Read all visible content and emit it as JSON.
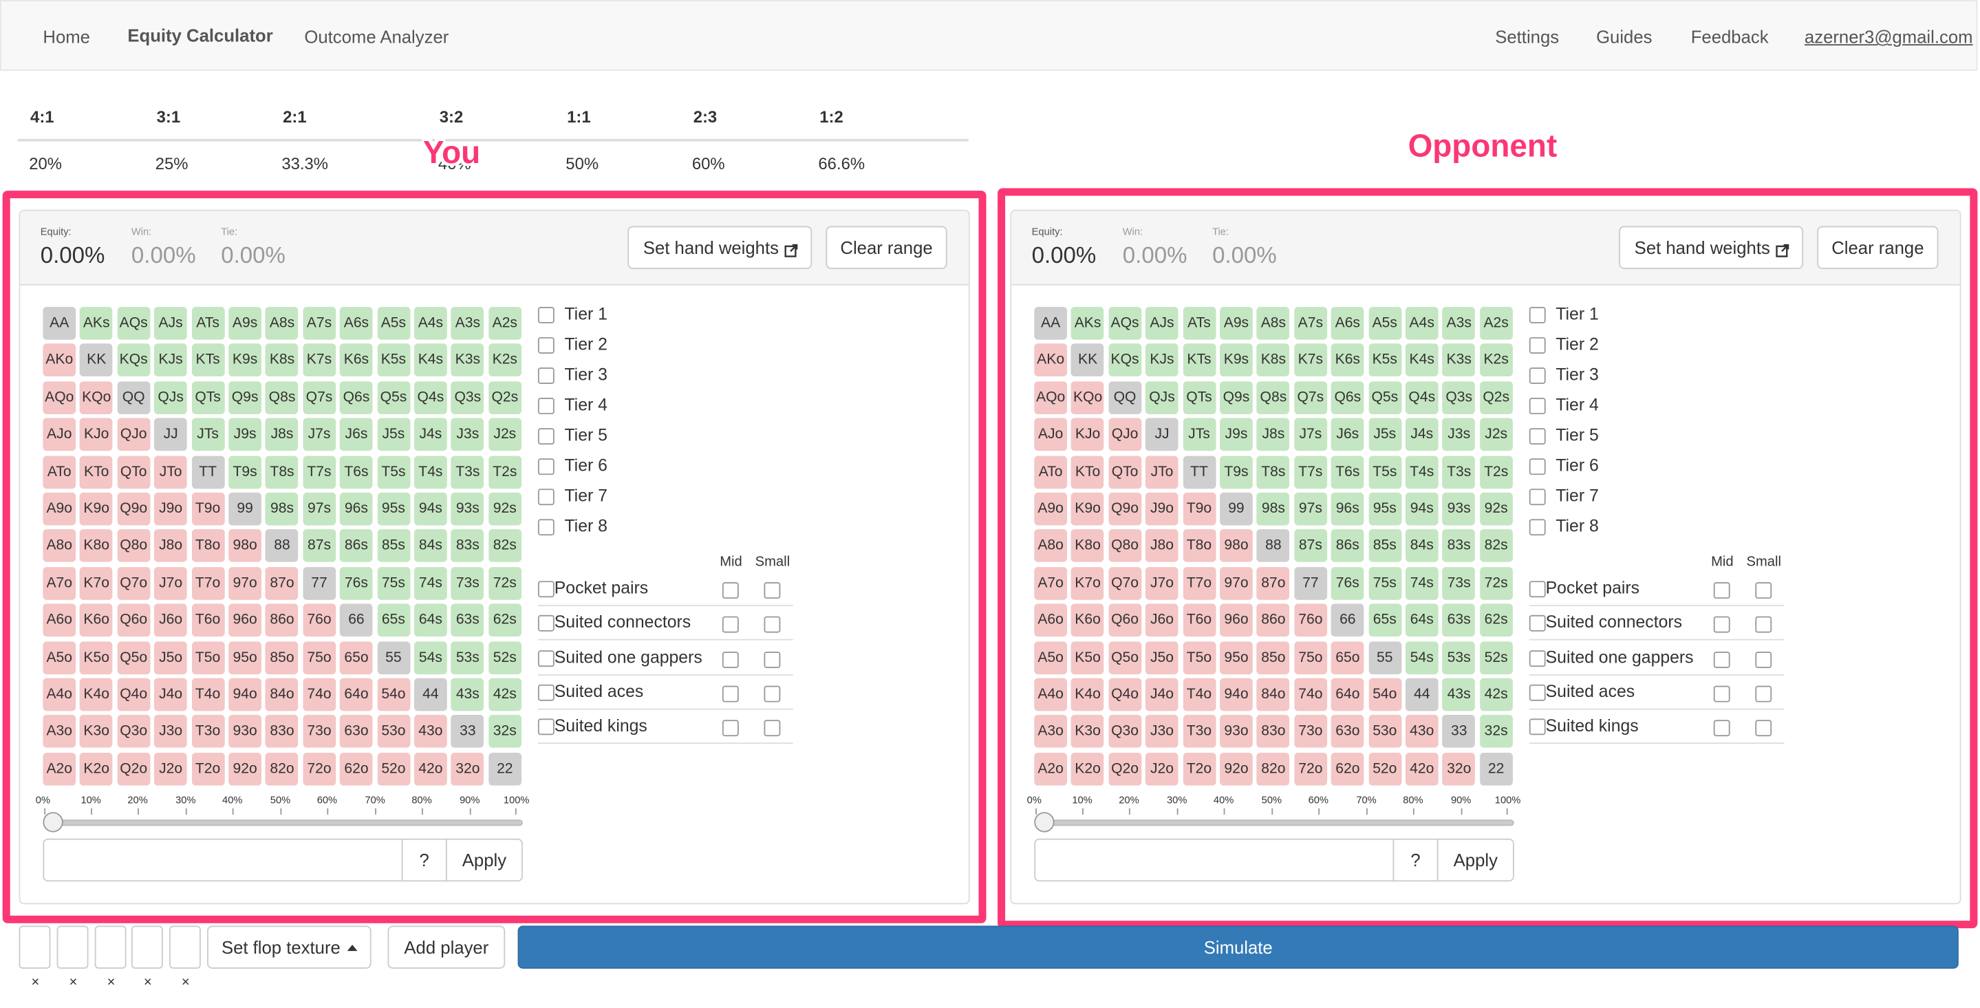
{
  "nav": {
    "home": "Home",
    "equity_calculator": "Equity Calculator",
    "outcome_analyzer": "Outcome Analyzer",
    "settings": "Settings",
    "guides": "Guides",
    "feedback": "Feedback",
    "user_email": "azerner3@gmail.com"
  },
  "odds_table": {
    "headers": [
      "4:1",
      "3:1",
      "2:1",
      "3:2",
      "1:1",
      "2:3",
      "1:2"
    ],
    "values": [
      "20%",
      "25%",
      "33.3%",
      "40%",
      "50%",
      "60%",
      "66.6%"
    ]
  },
  "annotations": {
    "you": "You",
    "opponent": "Opponent",
    "highlight_color": "#fb3774"
  },
  "panels": [
    {
      "equity_label": "Equity:",
      "equity_value": "0.00%",
      "win_label": "Win:",
      "win_value": "0.00%",
      "tie_label": "Tie:",
      "tie_value": "0.00%",
      "set_hand_weights": "Set hand weights",
      "clear_range": "Clear range",
      "range_input_value": "",
      "help_button": "?",
      "apply_button": "Apply",
      "slider_percent": 0
    },
    {
      "equity_label": "Equity:",
      "equity_value": "0.00%",
      "win_label": "Win:",
      "win_value": "0.00%",
      "tie_label": "Tie:",
      "tie_value": "0.00%",
      "set_hand_weights": "Set hand weights",
      "clear_range": "Clear range",
      "range_input_value": "",
      "help_button": "?",
      "apply_button": "Apply",
      "slider_percent": 0
    }
  ],
  "hand_grid": [
    [
      "AA",
      "AKs",
      "AQs",
      "AJs",
      "ATs",
      "A9s",
      "A8s",
      "A7s",
      "A6s",
      "A5s",
      "A4s",
      "A3s",
      "A2s"
    ],
    [
      "AKo",
      "KK",
      "KQs",
      "KJs",
      "KTs",
      "K9s",
      "K8s",
      "K7s",
      "K6s",
      "K5s",
      "K4s",
      "K3s",
      "K2s"
    ],
    [
      "AQo",
      "KQo",
      "QQ",
      "QJs",
      "QTs",
      "Q9s",
      "Q8s",
      "Q7s",
      "Q6s",
      "Q5s",
      "Q4s",
      "Q3s",
      "Q2s"
    ],
    [
      "AJo",
      "KJo",
      "QJo",
      "JJ",
      "JTs",
      "J9s",
      "J8s",
      "J7s",
      "J6s",
      "J5s",
      "J4s",
      "J3s",
      "J2s"
    ],
    [
      "ATo",
      "KTo",
      "QTo",
      "JTo",
      "TT",
      "T9s",
      "T8s",
      "T7s",
      "T6s",
      "T5s",
      "T4s",
      "T3s",
      "T2s"
    ],
    [
      "A9o",
      "K9o",
      "Q9o",
      "J9o",
      "T9o",
      "99",
      "98s",
      "97s",
      "96s",
      "95s",
      "94s",
      "93s",
      "92s"
    ],
    [
      "A8o",
      "K8o",
      "Q8o",
      "J8o",
      "T8o",
      "98o",
      "88",
      "87s",
      "86s",
      "85s",
      "84s",
      "83s",
      "82s"
    ],
    [
      "A7o",
      "K7o",
      "Q7o",
      "J7o",
      "T7o",
      "97o",
      "87o",
      "77",
      "76s",
      "75s",
      "74s",
      "73s",
      "72s"
    ],
    [
      "A6o",
      "K6o",
      "Q6o",
      "J6o",
      "T6o",
      "96o",
      "86o",
      "76o",
      "66",
      "65s",
      "64s",
      "63s",
      "62s"
    ],
    [
      "A5o",
      "K5o",
      "Q5o",
      "J5o",
      "T5o",
      "95o",
      "85o",
      "75o",
      "65o",
      "55",
      "54s",
      "53s",
      "52s"
    ],
    [
      "A4o",
      "K4o",
      "Q4o",
      "J4o",
      "T4o",
      "94o",
      "84o",
      "74o",
      "64o",
      "54o",
      "44",
      "43s",
      "42s"
    ],
    [
      "A3o",
      "K3o",
      "Q3o",
      "J3o",
      "T3o",
      "93o",
      "83o",
      "73o",
      "63o",
      "53o",
      "43o",
      "33",
      "32s"
    ],
    [
      "A2o",
      "K2o",
      "Q2o",
      "J2o",
      "T2o",
      "92o",
      "82o",
      "72o",
      "62o",
      "52o",
      "42o",
      "32o",
      "22"
    ]
  ],
  "cell_colors": {
    "suited": "#c5e6c2",
    "offsuit": "#f4c6c6",
    "pair": "#cfcfcf"
  },
  "tiers": [
    "Tier 1",
    "Tier 2",
    "Tier 3",
    "Tier 4",
    "Tier 5",
    "Tier 6",
    "Tier 7",
    "Tier 8"
  ],
  "categories": {
    "mid_header": "Mid",
    "small_header": "Small",
    "items": [
      "Pocket pairs",
      "Suited connectors",
      "Suited one gappers",
      "Suited aces",
      "Suited kings"
    ]
  },
  "slider_ticks": [
    "0%",
    "10%",
    "20%",
    "30%",
    "40%",
    "50%",
    "60%",
    "70%",
    "80%",
    "90%",
    "100%"
  ],
  "board": {
    "card_slots": [
      "",
      "",
      "",
      "",
      ""
    ],
    "remove_symbol": "×",
    "set_flop_texture": "Set flop texture",
    "add_player": "Add player",
    "simulate": "Simulate"
  }
}
